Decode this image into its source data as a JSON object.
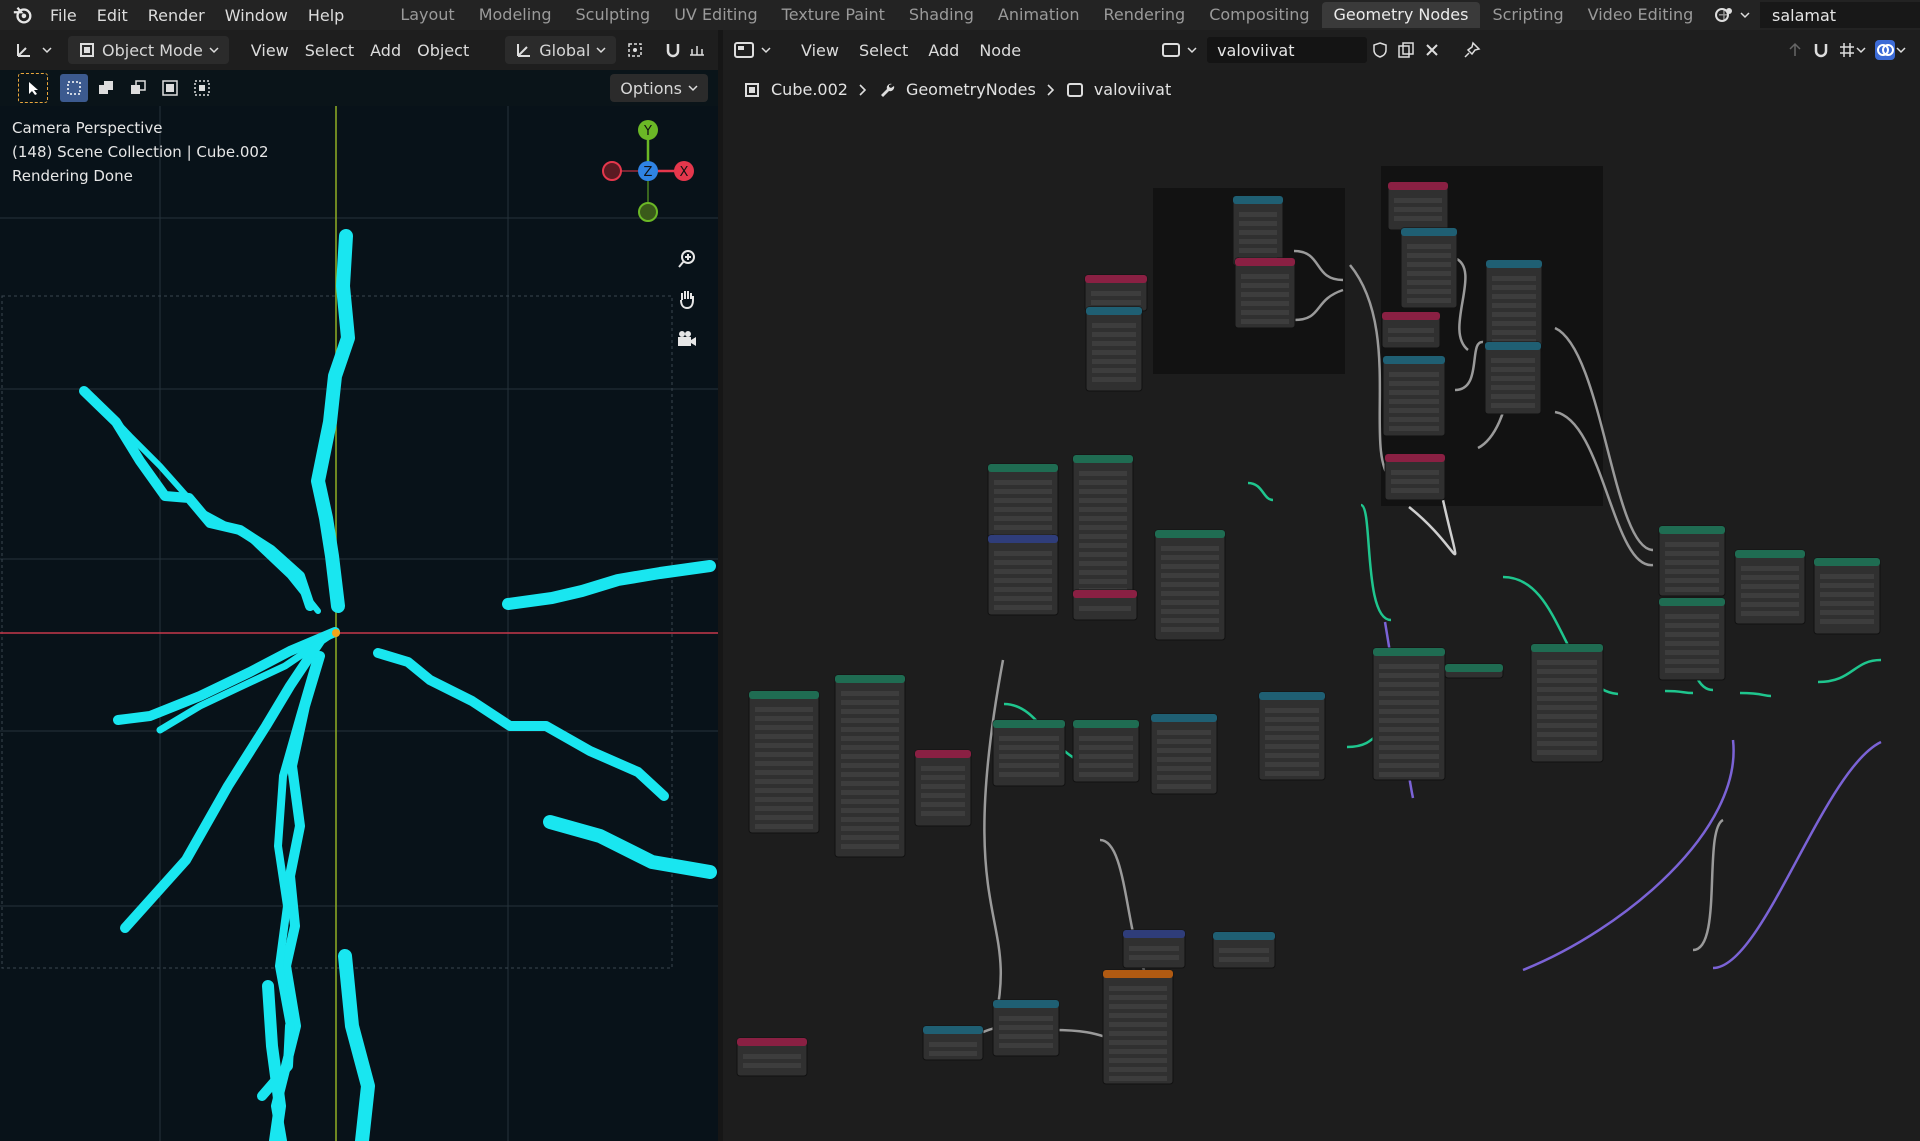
{
  "topbar": {
    "menus": [
      "File",
      "Edit",
      "Render",
      "Window",
      "Help"
    ],
    "workspaces": [
      "Layout",
      "Modeling",
      "Sculpting",
      "UV Editing",
      "Texture Paint",
      "Shading",
      "Animation",
      "Rendering",
      "Compositing",
      "Geometry Nodes",
      "Scripting",
      "Video Editing"
    ],
    "active_workspace": "Geometry Nodes",
    "add_workspace": "+",
    "user": "salamat"
  },
  "viewport": {
    "mode": "Object Mode",
    "menus": [
      "View",
      "Select",
      "Add",
      "Object"
    ],
    "transform_orientation": "Global",
    "options_label": "Options",
    "overlay_lines": [
      "Camera Perspective",
      "(148) Scene Collection | Cube.002",
      "Rendering Done"
    ],
    "gizmo": {
      "x": "X",
      "y": "Y",
      "z": "Z",
      "x_color": "#e5374c",
      "y_color": "#6bb826",
      "z_color": "#2f83e3"
    },
    "stroke_color": "#19e6f0"
  },
  "node_editor": {
    "menus": [
      "View",
      "Select",
      "Add",
      "Node"
    ],
    "tree_name": "valoviivat",
    "breadcrumb": [
      "Cube.002",
      "GeometryNodes",
      "valoviivat"
    ],
    "header_colors": {
      "geometry": "#1f6c52",
      "input": "#8a2043",
      "vector": "#2f3d7a",
      "converter": "#1f5f73",
      "texture": "#b05a12"
    }
  }
}
